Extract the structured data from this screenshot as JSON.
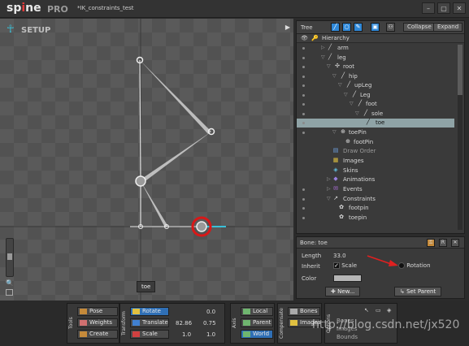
{
  "app": {
    "logo_text_a": "sp",
    "logo_text_o": "i",
    "logo_text_b": "ne",
    "edition": "PRO",
    "project_title": "*IK_constraints_test",
    "window_buttons": [
      "–",
      "▢",
      "✕"
    ]
  },
  "viewport": {
    "mode_label": "SETUP",
    "selected_bone_tag": "toe"
  },
  "tree": {
    "title": "Tree",
    "collapse_label": "Collapse",
    "expand_label": "Expand",
    "hierarchy_label": "Hierarchy",
    "rows": [
      {
        "label": "arm",
        "icon": "bone-icon"
      },
      {
        "label": "leg",
        "icon": "bone-icon"
      },
      {
        "label": "root",
        "icon": "root-icon"
      },
      {
        "label": "hip",
        "icon": "bone-icon"
      },
      {
        "label": "upLeg",
        "icon": "bone-icon"
      },
      {
        "label": "Leg",
        "icon": "bone-icon"
      },
      {
        "label": "foot",
        "icon": "bone-icon"
      },
      {
        "label": "sole",
        "icon": "bone-icon"
      },
      {
        "label": "toe",
        "icon": "bone-icon"
      },
      {
        "label": "toePin",
        "icon": "target-icon"
      },
      {
        "label": "footPin",
        "icon": "target-icon"
      },
      {
        "label": "Draw Order",
        "icon": "draw-order-icon"
      },
      {
        "label": "Images",
        "icon": "images-icon"
      },
      {
        "label": "Skins",
        "icon": "skins-icon"
      },
      {
        "label": "Animations",
        "icon": "animations-icon"
      },
      {
        "label": "Events",
        "icon": "events-icon"
      },
      {
        "label": "Constraints",
        "icon": "constraints-icon"
      },
      {
        "label": "footpin",
        "icon": "ik-icon"
      },
      {
        "label": "toepin",
        "icon": "ik-icon"
      }
    ]
  },
  "bone": {
    "header": "Bone: toe",
    "length_label": "Length",
    "length_value": "33.0",
    "inherit_label": "Inherit",
    "scale_label": "Scale",
    "rotation_label": "Rotation",
    "color_label": "Color",
    "new_button": "New...",
    "set_parent_button": "Set Parent",
    "color_value": "#b5b5b5"
  },
  "toolbar": {
    "tools_label": "Tools",
    "pose": "Pose",
    "weights": "Weights",
    "create": "Create",
    "transform_label": "Transform",
    "rotate": "Rotate",
    "rotate_val": "0.0",
    "translate": "Translate",
    "translate_x": "82.86",
    "translate_y": "0.75",
    "scale": "Scale",
    "scale_x": "1.0",
    "scale_y": "1.0",
    "axis_label": "Axis",
    "local": "Local",
    "parent": "Parent",
    "world": "World",
    "compensate_label": "Compensate",
    "bones": "Bones",
    "images": "Images",
    "options_label": "Options",
    "opt_bones": "Bones",
    "opt_images": "Images",
    "opt_bounds": "Bounds"
  },
  "watermark": "http://blog.csdn.net/jx520",
  "colors": {
    "accent_blue": "#2f6fb5",
    "selection": "#8fa3a6",
    "annotation_red": "#e02020"
  }
}
